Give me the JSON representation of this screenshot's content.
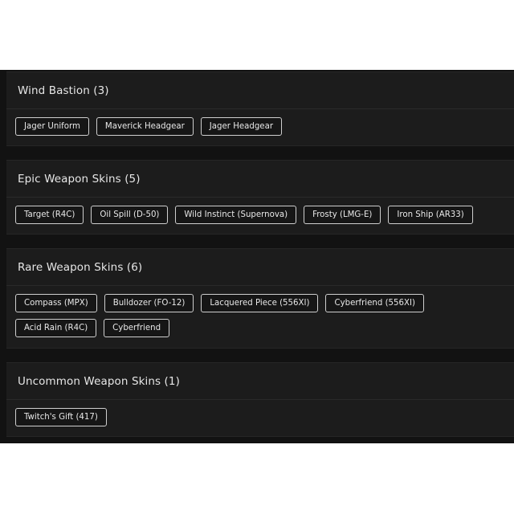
{
  "sections": [
    {
      "title": "Wind Bastion (3)",
      "items": [
        "Jager Uniform",
        "Maverick Headgear",
        "Jager Headgear"
      ]
    },
    {
      "title": "Epic Weapon Skins (5)",
      "items": [
        "Target (R4C)",
        "Oil Spill (D-50)",
        "Wild Instinct (Supernova)",
        "Frosty (LMG-E)",
        "Iron Ship (AR33)"
      ]
    },
    {
      "title": "Rare Weapon Skins (6)",
      "items": [
        "Compass (MPX)",
        "Bulldozer (FO-12)",
        "Lacquered Piece (556XI)",
        "Cyberfriend (556XI)",
        "Acid Rain (R4C)",
        "Cyberfriend"
      ]
    },
    {
      "title": "Uncommon Weapon Skins (1)",
      "items": [
        "Twitch's Gift (417)"
      ]
    }
  ],
  "colors": {
    "panel_background": "#121212",
    "section_background": "#1c1c1c",
    "tag_border": "#cfcfcf",
    "text": "#e6e6e6"
  }
}
